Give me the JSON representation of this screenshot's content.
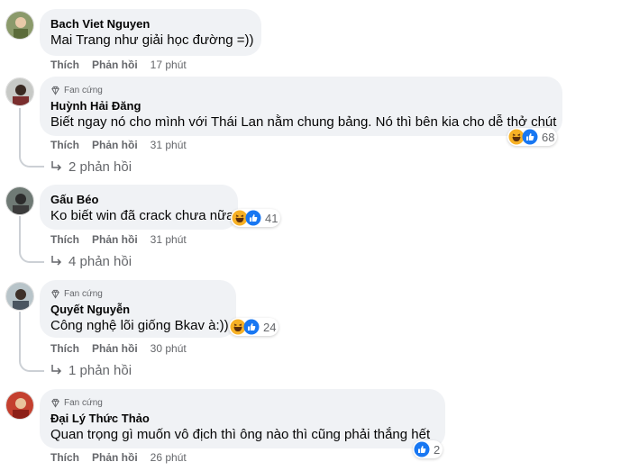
{
  "actions": {
    "like": "Thích",
    "reply": "Phản hồi"
  },
  "fan_label": "Fan cứng",
  "comments": [
    {
      "author": "Bach Viet Nguyen",
      "mention": "Mai Trang",
      "text": " như giải học đường =))",
      "time": "17 phút"
    },
    {
      "author": "Huỳnh Hải Đăng",
      "text": "Biết ngay nó cho mình với Thái Lan nằm chung bảng. Nó thì bên kia cho dễ thở chút",
      "time": "31 phút",
      "reaction_count": "68",
      "replies": "2 phản hồi"
    },
    {
      "author": "Gấu Béo",
      "text": "Ko biết win đã crack chưa nữa",
      "time": "31 phút",
      "reaction_count": "41",
      "replies": "4 phản hồi"
    },
    {
      "author": "Quyết Nguyễn",
      "text": "Công nghệ lõi giống Bkav à:))",
      "time": "30 phút",
      "reaction_count": "24",
      "replies": "1 phản hồi"
    },
    {
      "author": "Đại Lý Thức Thảo",
      "text": "Quan trọng gì muốn vô địch thì ông nào thì cũng phải thắng hết",
      "time": "26 phút",
      "reaction_count": "2"
    }
  ],
  "colors": {
    "bubble": "#f0f2f5",
    "secondary_text": "#65676b",
    "like_blue": "#1877f2",
    "haha_yellow": "#f7b125"
  }
}
